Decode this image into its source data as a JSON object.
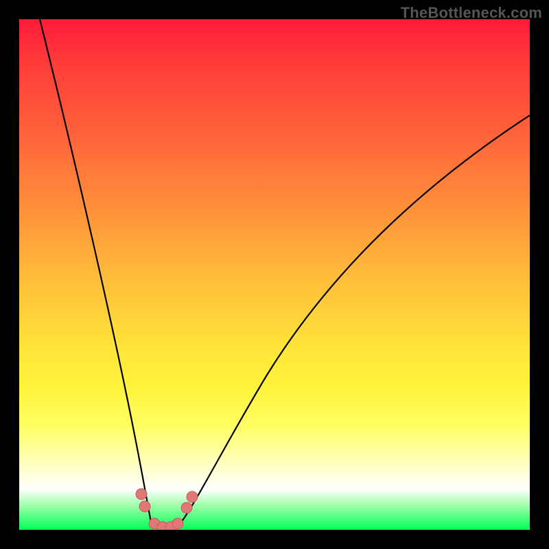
{
  "watermark": "TheBottleneck.com",
  "chart_data": {
    "type": "line",
    "title": "",
    "xlabel": "",
    "ylabel": "",
    "xlim": [
      0,
      100
    ],
    "ylim": [
      0,
      100
    ],
    "grid": false,
    "series": [
      {
        "name": "left-branch",
        "x": [
          4,
          8,
          12,
          16,
          19,
          21,
          23,
          24.5,
          25.5
        ],
        "y": [
          100,
          82,
          62,
          41,
          25,
          14,
          7,
          3,
          1
        ]
      },
      {
        "name": "valley-floor",
        "x": [
          25.5,
          27,
          28.5,
          30,
          31.5
        ],
        "y": [
          1,
          0.4,
          0.3,
          0.4,
          1
        ]
      },
      {
        "name": "right-branch",
        "x": [
          31.5,
          34,
          38,
          44,
          52,
          62,
          74,
          88,
          100
        ],
        "y": [
          1,
          4,
          12,
          25,
          40,
          54,
          66,
          75,
          82
        ]
      }
    ],
    "annotations": [
      {
        "name": "bead-left-1",
        "x": 23.5,
        "y": 6
      },
      {
        "name": "bead-left-2",
        "x": 24.3,
        "y": 3.5
      },
      {
        "name": "bead-floor-1",
        "x": 26.2,
        "y": 1.2
      },
      {
        "name": "bead-floor-2",
        "x": 27.8,
        "y": 0.8
      },
      {
        "name": "bead-floor-3",
        "x": 29.4,
        "y": 0.8
      },
      {
        "name": "bead-floor-4",
        "x": 30.8,
        "y": 1.2
      },
      {
        "name": "bead-right-1",
        "x": 32.6,
        "y": 4
      },
      {
        "name": "bead-right-2",
        "x": 33.6,
        "y": 6
      }
    ],
    "background_gradient": {
      "top": "#ff1a3a",
      "mid": "#fff23a",
      "bottom": "#00ff55"
    }
  }
}
